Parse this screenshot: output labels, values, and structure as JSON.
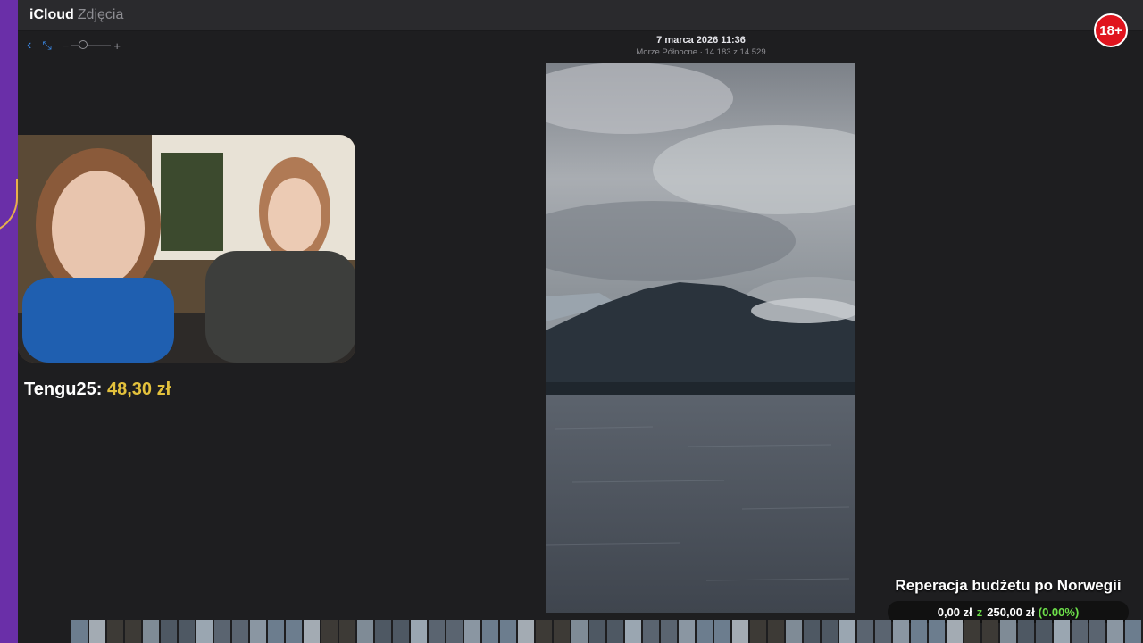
{
  "app": {
    "brand": "iCloud",
    "section": "Zdjęcia"
  },
  "badge": {
    "label": "18+"
  },
  "toolbar": {
    "back_icon": "chevron-left-icon",
    "expand_icon": "expand-icon",
    "zoom_minus": "−",
    "zoom_plus": "+",
    "zoom_level": 0.1
  },
  "photo": {
    "date": "7 marca 2026 11:36",
    "meta": "Morze Północne · 14 183 z 14 529"
  },
  "donation": {
    "user": "Tengu25:",
    "amount": "48,30 zł"
  },
  "goal": {
    "title": "Reperacja budżetu po Norwegii",
    "current": "0,00 zł",
    "separator": "z",
    "target": "250,00 zł",
    "percent": "(0.00%)"
  },
  "colors": {
    "accent_blue": "#3b8ced",
    "gold": "#e3c13c",
    "green": "#6de04a",
    "badge_red": "#e0141e",
    "side_purple": "#6a2fa8"
  }
}
